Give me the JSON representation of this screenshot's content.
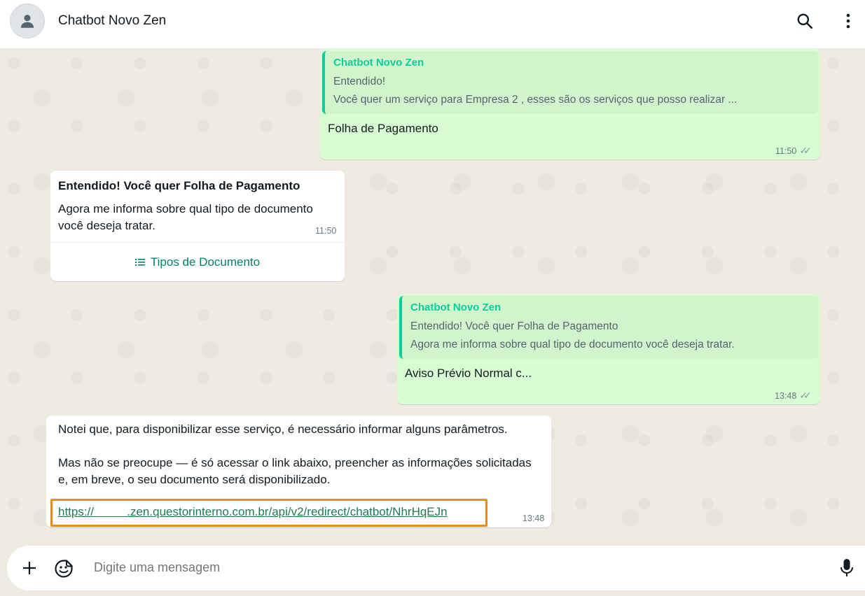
{
  "header": {
    "contact_name": "Chatbot Novo Zen"
  },
  "messages": {
    "m1": {
      "quote_name": "Chatbot Novo Zen",
      "quote_line1": "Entendido!",
      "quote_line2": "Você quer um serviço para Empresa 2 , esses são os serviços que posso realizar ...",
      "text": "Folha de Pagamento",
      "time": "11:50",
      "status": "read"
    },
    "m2": {
      "title": "Entendido! Você quer Folha de Pagamento",
      "body_line1": "Agora me informa sobre qual tipo de documento",
      "body_line2": "você deseja tratar.",
      "time": "11:50",
      "list_button": "Tipos de Documento"
    },
    "m3": {
      "quote_name": "Chatbot Novo Zen",
      "quote_line1": "Entendido! Você quer Folha de Pagamento",
      "quote_line2": "Agora me informa sobre qual tipo de documento você deseja tratar.",
      "text": "Aviso Prévio Normal c...",
      "time": "13:48",
      "status": "read"
    },
    "m4": {
      "line1": "Notei que, para disponibilizar esse serviço, é necessário informar alguns parâmetros.",
      "line2": "Mas não se preocupe — é só acessar o link abaixo, preencher as informações solicitadas",
      "line3": "e, em breve, o seu documento será disponibilizado.",
      "link": "https://          .zen.questorinterno.com.br/api/v2/redirect/chatbot/NhrHqEJn",
      "time": "13:48"
    }
  },
  "composer": {
    "placeholder": "Digite uma mensagem"
  },
  "colors": {
    "outgoing_bubble": "#d9fdd3",
    "incoming_bubble": "#ffffff",
    "accent": "#06cf9c",
    "highlight_box": "#f28a1a"
  }
}
